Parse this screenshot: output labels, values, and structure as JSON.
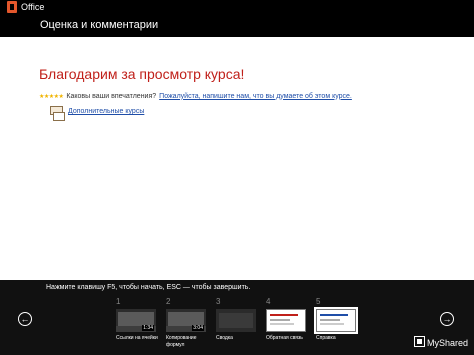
{
  "header": {
    "office_label": "Office",
    "title": "Оценка и комментарии"
  },
  "main": {
    "thanks_text": "Благодарим за просмотр курса!",
    "stars": "★★★★★",
    "rating_question": "Каковы ваши впечатления?",
    "feedback_link": "Пожалуйста, напишите нам, что вы думаете об этом курсе.",
    "more_courses_link": "Дополнительные курсы"
  },
  "footer": {
    "instructions": "Нажмите клавишу F5, чтобы начать, ESC — чтобы завершить.",
    "prev_icon": "prev-arrow-icon",
    "next_icon": "next-arrow-icon",
    "slides": [
      {
        "number": "1",
        "label": "Ссылки на ячейки",
        "duration": "1:34"
      },
      {
        "number": "2",
        "label": "Копирование формул",
        "duration": "3:04"
      },
      {
        "number": "3",
        "label": "Сводка",
        "duration": ""
      },
      {
        "number": "4",
        "label": "Обратная связь",
        "duration": ""
      },
      {
        "number": "5",
        "label": "Справка",
        "duration": ""
      }
    ],
    "watermark": "MyShared"
  },
  "colors": {
    "accent_red": "#c0201a",
    "link_blue": "#1f4ea8",
    "logo_orange": "#e3572c"
  }
}
